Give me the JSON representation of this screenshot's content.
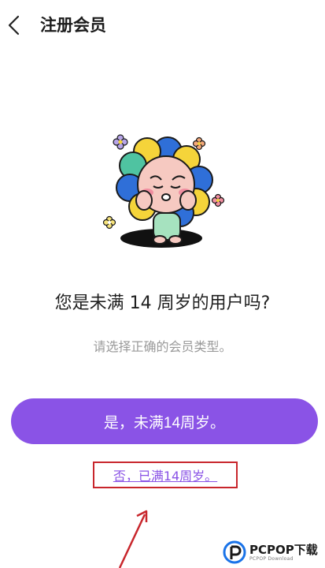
{
  "header": {
    "title": "注册会员",
    "back_icon": "chevron-left-icon"
  },
  "content": {
    "question": "您是未满 14 周岁的用户吗?",
    "hint": "请选择正确的会员类型。",
    "primary_button": "是，未满14周岁。",
    "secondary_link": "否，已满14周岁。"
  },
  "colors": {
    "accent": "#8a53e6",
    "annotation": "#c8262c"
  },
  "watermark": {
    "brand": "PCPOP下载",
    "sub": "PCPOP Download"
  }
}
